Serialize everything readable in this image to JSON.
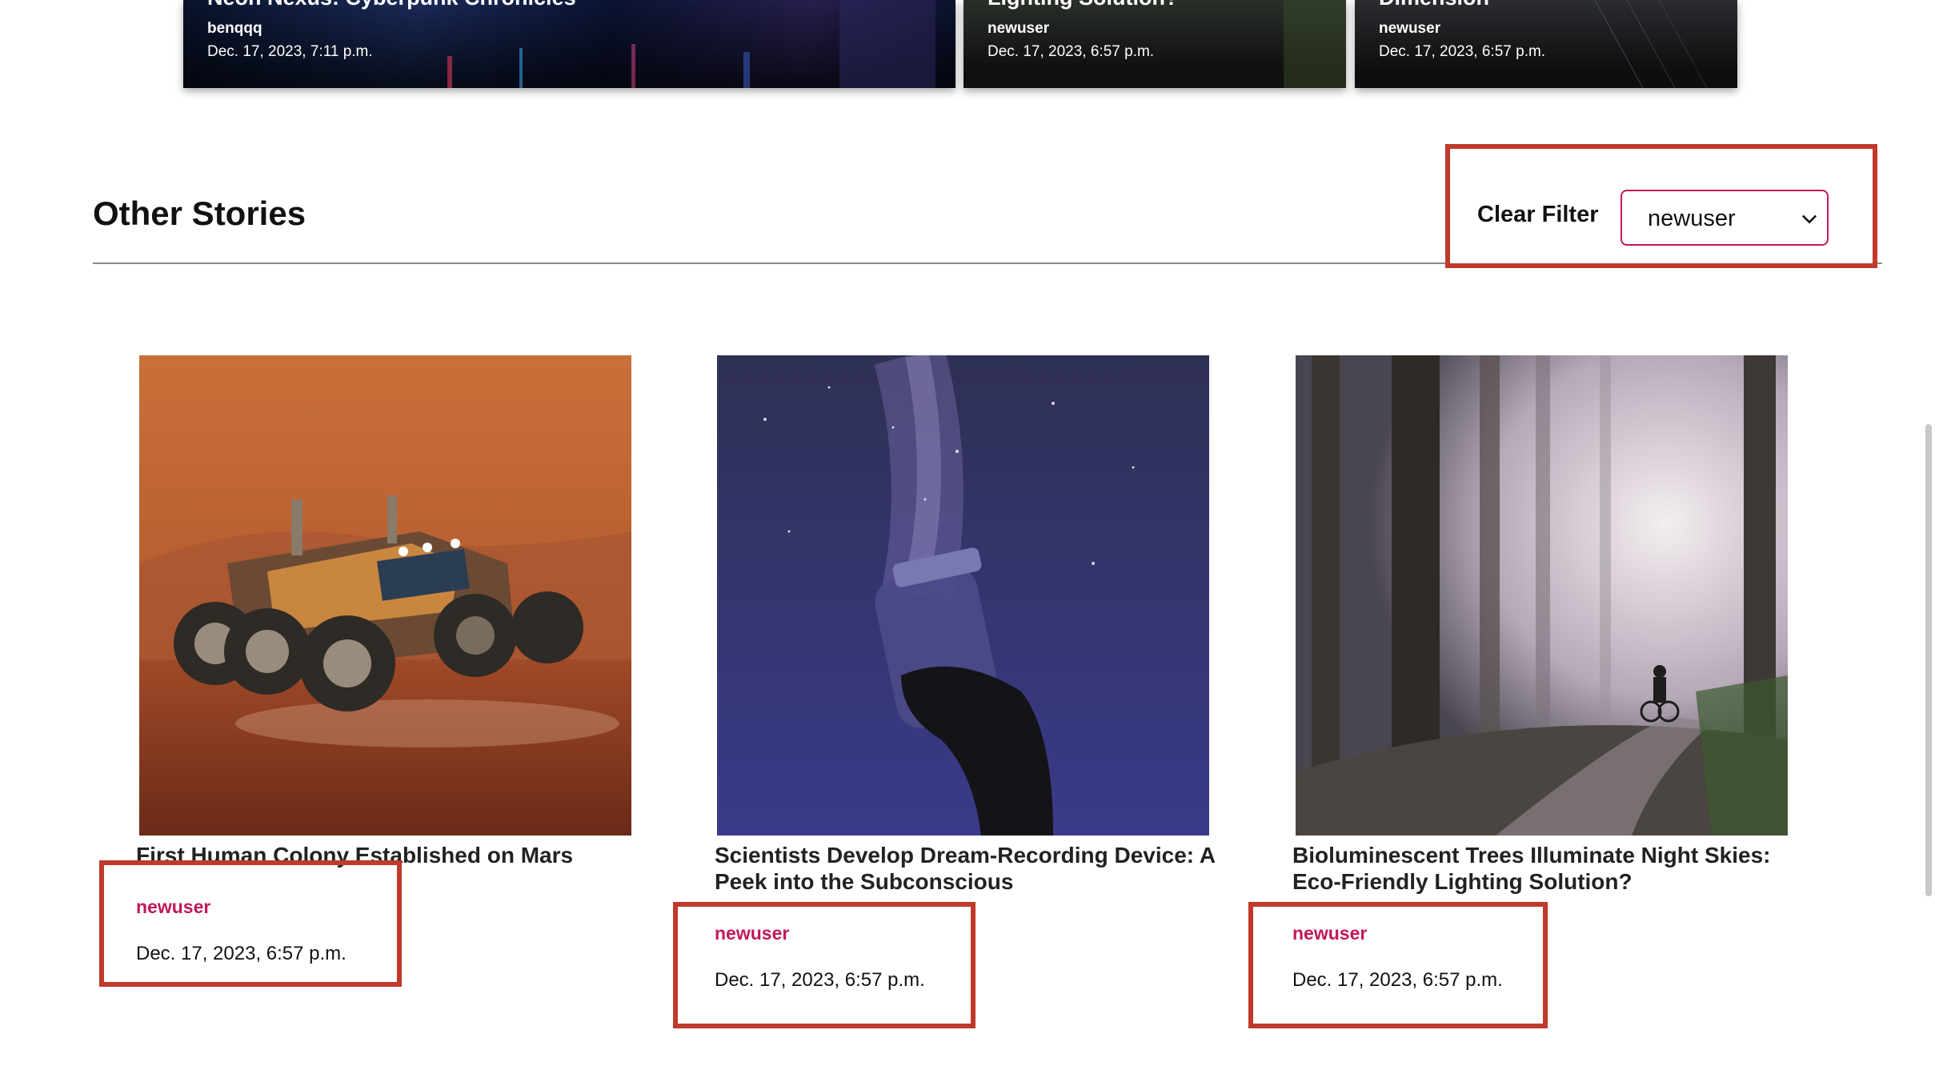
{
  "featured": [
    {
      "title": "Neon Nexus: Cyberpunk Chronicles",
      "author": "benqqq",
      "date": "Dec. 17, 2023, 7:11 p.m."
    },
    {
      "title": "Lighting Solution?",
      "author": "newuser",
      "date": "Dec. 17, 2023, 6:57 p.m."
    },
    {
      "title": "Dimension",
      "author": "newuser",
      "date": "Dec. 17, 2023, 6:57 p.m."
    }
  ],
  "section": {
    "title": "Other Stories",
    "clear_filter": "Clear Filter",
    "filter_value": "newuser"
  },
  "stories": [
    {
      "title": "First Human Colony Established on Mars",
      "author": "newuser",
      "date": "Dec. 17, 2023, 6:57 p.m."
    },
    {
      "title": "Scientists Develop Dream-Recording Device: A Peek into the Subconscious",
      "author": "newuser",
      "date": "Dec. 17, 2023, 6:57 p.m."
    },
    {
      "title": "Bioluminescent Trees Illuminate Night Skies: Eco-Friendly Lighting Solution?",
      "author": "newuser",
      "date": "Dec. 17, 2023, 6:57 p.m."
    }
  ],
  "colors": {
    "accent": "#c2185b",
    "highlight": "#c0392b"
  }
}
